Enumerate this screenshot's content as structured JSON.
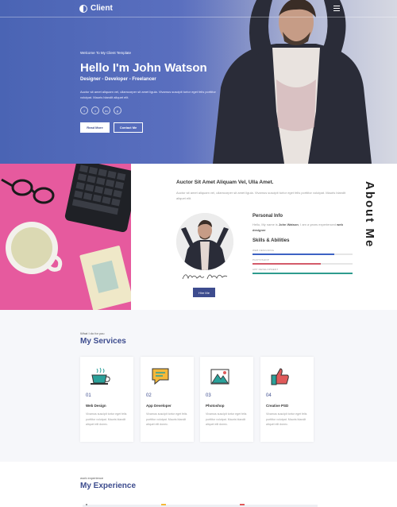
{
  "nav": {
    "logo": "Client"
  },
  "hero": {
    "eyebrow": "Welcome To My Client Template",
    "title": "Hello I'm John Watson",
    "subtitle": "Designer - Developer - Freelancer",
    "text": "Auctor sit amet aliquam vel, ullamcorper sit amet ligula. Vivamus suscipit tortor eget felis porttitor volutpat. Mauris blandit aliquet elit.",
    "socials": [
      "f",
      "t",
      "in",
      "p"
    ],
    "read_more": "Read More",
    "contact_me": "Contact Me"
  },
  "about": {
    "headline": "Auctor Sit Amet Aliquam Vel, Ulla Amet.",
    "paragraph": "Auctor sit amet aliquam vel, ullamcorper sit amet ligula. Vivamus suscipit tortor eget felis porttitor volutpat. Mauris blandit aliquet elit.",
    "side_title": "About Me",
    "signature": "Alejandro Smith",
    "personal_title": "Personal Info",
    "personal_prefix": "Hello, My name is ",
    "personal_name": "John Watson",
    "personal_mid": ", I am a years experienced ",
    "personal_role": "web designer",
    "skills_title": "Skills & Abilities",
    "skills": [
      {
        "label": "WEB DESIGNING",
        "level": 0.82,
        "color": "#3d62c4"
      },
      {
        "label": "PHOTOSHOP",
        "level": 0.68,
        "color": "#d45b6a"
      },
      {
        "label": "APP DEVELOPMENT",
        "level": 1.0,
        "color": "#2e9c8e"
      }
    ],
    "hire_me": "Hire Me"
  },
  "services": {
    "eyebrow": "What I do for you",
    "title": "My Services",
    "items": [
      {
        "num": "01",
        "name": "Web Design",
        "text": "Vivamus suscipit tortor eget felis porttitor volutpat. Mauris blandit aliquet elit donec.",
        "icon": "coffee-cup-icon"
      },
      {
        "num": "02",
        "name": "App Developer",
        "text": "Vivamus suscipit tortor eget felis porttitor volutpat. Mauris blandit aliquet elit donec.",
        "icon": "chat-bubble-icon"
      },
      {
        "num": "03",
        "name": "Photoshop",
        "text": "Vivamus suscipit tortor eget felis porttitor volutpat. Mauris blandit aliquet elit donec.",
        "icon": "mountain-picture-icon"
      },
      {
        "num": "04",
        "name": "Creative PSD",
        "text": "Vivamus suscipit tortor eget felis porttitor volutpat. Mauris blandit aliquet elit donec.",
        "icon": "thumbs-up-icon"
      }
    ]
  },
  "experience": {
    "eyebrow": "work experience",
    "title": "My Experience"
  },
  "colors": {
    "primary": "#3d4c8e",
    "hero_gradient_start": "#4a64b4",
    "about_photo_bg": "#e65a9e"
  }
}
